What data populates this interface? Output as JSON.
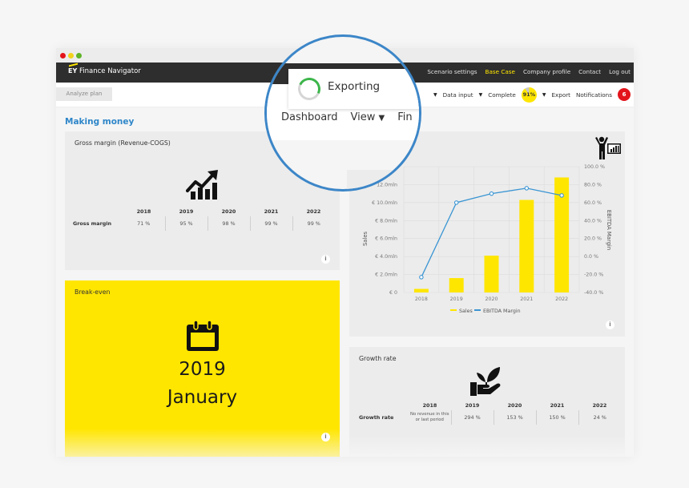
{
  "window": {
    "brand": {
      "logo": "EY",
      "name": "Finance Navigator"
    },
    "top_nav": [
      "Scenario settings",
      "Base Case",
      "Company profile",
      "Contact",
      "Log out"
    ],
    "top_nav_active": "Base Case",
    "sub_nav": {
      "analyze_button": "Analyze plan",
      "data_input": "Data input",
      "complete_label": "Complete",
      "complete_percent": "91%",
      "complete_fraction": 0.91,
      "export": "Export",
      "notifications": "Notifications",
      "notification_count": "6"
    }
  },
  "lens": {
    "status": "Exporting",
    "menu": [
      "Dashboard",
      "View",
      "Fin"
    ],
    "spinner_icon": "loading-spinner-icon"
  },
  "section_title": "Making money",
  "gross_margin": {
    "title": "Gross margin (Revenue-COGS)",
    "icon": "growth-chart-icon",
    "years": [
      "2018",
      "2019",
      "2020",
      "2021",
      "2022"
    ],
    "row_label": "Gross margin",
    "values": [
      "71 %",
      "95 %",
      "98 %",
      "99 %",
      "99 %"
    ],
    "info": "i"
  },
  "break_even": {
    "title": "Break-even",
    "icon": "calendar-icon",
    "year": "2019",
    "month": "January",
    "info": "i"
  },
  "growth_rate": {
    "title": "Growth rate",
    "icon": "plant-in-hand-icon",
    "years": [
      "2018",
      "2019",
      "2020",
      "2021",
      "2022"
    ],
    "row_label": "Growth rate",
    "values": [
      "No revenue in this or last period",
      "294 %",
      "153 %",
      "150 %",
      "24 %"
    ],
    "info": "i"
  },
  "sales_card": {
    "icon": "person-presenting-chart-icon",
    "info": "i"
  },
  "chart_data": {
    "type": "bar",
    "title": "",
    "categories": [
      "2018",
      "2019",
      "2020",
      "2021",
      "2022"
    ],
    "series": [
      {
        "name": "Sales",
        "type": "bar",
        "axis": "left",
        "color": "#ffe600",
        "values": [
          0.4,
          1.6,
          4.1,
          10.3,
          12.8
        ]
      },
      {
        "name": "EBITDA Margin",
        "type": "line",
        "axis": "right",
        "color": "#3b95d3",
        "values": [
          -23,
          60,
          70,
          76,
          68
        ]
      }
    ],
    "ylabel": "Sales",
    "y2label": "EBITDA Margin",
    "ylim": [
      0,
      14
    ],
    "y_ticks": [
      0,
      2,
      4,
      6,
      8,
      10,
      12
    ],
    "y_tick_labels": [
      "€ 0",
      "€ 2.0mln",
      "€ 4.0mln",
      "€ 6.0mln",
      "€ 8.0mln",
      "€ 10.0mln",
      "12.0mln"
    ],
    "y2lim": [
      -40,
      100
    ],
    "y2_ticks": [
      -40,
      -20,
      0,
      20,
      40,
      60,
      80,
      100
    ],
    "y2_tick_labels": [
      "-40.0 %",
      "-20.0 %",
      "0.0 %",
      "20.0 %",
      "40.0 %",
      "60.0 %",
      "80.0 %",
      "100.0 %"
    ],
    "grid": true,
    "legend": "bottom"
  }
}
